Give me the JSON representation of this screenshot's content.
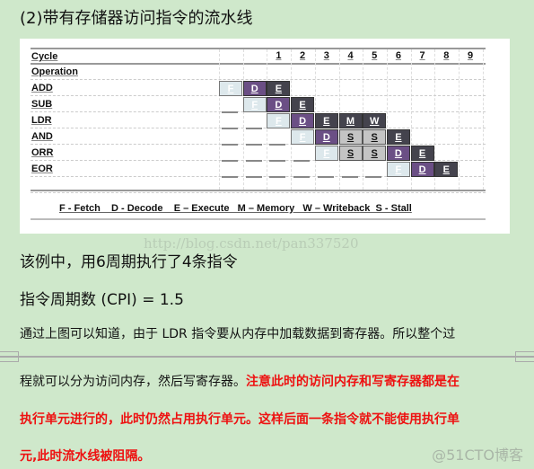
{
  "title": "(2)带有存储器访问指令的流水线",
  "diagram": {
    "header_labels": [
      "Cycle",
      "Operation"
    ],
    "cycle_numbers": [
      "1",
      "2",
      "3",
      "4",
      "5",
      "6",
      "7",
      "8",
      "9"
    ],
    "instructions": [
      {
        "name": "ADD",
        "stages": [
          {
            "col": 0,
            "s": "F"
          },
          {
            "col": 1,
            "s": "D"
          },
          {
            "col": 2,
            "s": "E"
          }
        ]
      },
      {
        "name": "SUB",
        "stages": [
          {
            "col": 1,
            "s": "F"
          },
          {
            "col": 2,
            "s": "D"
          },
          {
            "col": 3,
            "s": "E"
          }
        ]
      },
      {
        "name": "LDR",
        "stages": [
          {
            "col": 2,
            "s": "F"
          },
          {
            "col": 3,
            "s": "D"
          },
          {
            "col": 4,
            "s": "E"
          },
          {
            "col": 5,
            "s": "M"
          },
          {
            "col": 6,
            "s": "W"
          }
        ]
      },
      {
        "name": "AND",
        "stages": [
          {
            "col": 3,
            "s": "F"
          },
          {
            "col": 4,
            "s": "D"
          },
          {
            "col": 5,
            "s": "S"
          },
          {
            "col": 6,
            "s": "S"
          },
          {
            "col": 7,
            "s": "E"
          }
        ]
      },
      {
        "name": "ORR",
        "stages": [
          {
            "col": 4,
            "s": "F"
          },
          {
            "col": 5,
            "s": "S"
          },
          {
            "col": 6,
            "s": "S"
          },
          {
            "col": 7,
            "s": "D"
          },
          {
            "col": 8,
            "s": "E"
          }
        ]
      },
      {
        "name": "EOR",
        "stages": [
          {
            "col": 7,
            "s": "F"
          },
          {
            "col": 8,
            "s": "D"
          },
          {
            "col": 9,
            "s": "E"
          }
        ]
      }
    ],
    "legend": "F - Fetch    D - Decode    E – Execute   M – Memory   W – Writeback  S - Stall",
    "colors": {
      "F": "#dde8ec",
      "D": "#6b4f85",
      "E": "#44434d",
      "S": "#c4c4c4"
    }
  },
  "watermark": "http://blog.csdn.net/pan337520",
  "para1": "该例中，用6周期执行了4条指令",
  "para2": "指令周期数 (CPI) = 1.5",
  "para3": "通过上图可以知道，由于 LDR 指令要从内存中加载数据到寄存器。所以整个过",
  "para4_black": "程就可以分为访问内存，然后写寄存器。",
  "para4_red": "注意此时的访问内存和写寄存器都是在",
  "para5_red": "执行单元进行的，此时仍然占用执行单元。这样后面一条指令就不能使用执行单",
  "para6_red": "元,此时流水线被阻隔。",
  "site_logo": "@51CTO博客"
}
